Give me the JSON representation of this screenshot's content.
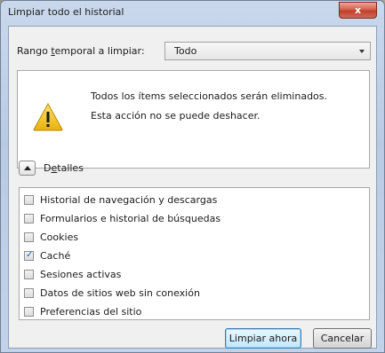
{
  "window": {
    "title": "Limpiar todo el historial",
    "close_glyph": "x"
  },
  "range": {
    "label_pre": "Rango ",
    "label_underlined": "t",
    "label_post": "emporal a limpiar:",
    "selected": "Todo"
  },
  "warning": {
    "icon": "warning-triangle-icon",
    "line1": "Todos los ítems seleccionados serán eliminados.",
    "line2": "Esta acción no se puede deshacer."
  },
  "details": {
    "label_pre": "D",
    "label_underlined": "e",
    "label_post": "talles",
    "expanded": true
  },
  "items": [
    {
      "label": "Historial de navegación y descargas",
      "checked": false
    },
    {
      "label": "Formularios e historial de búsquedas",
      "checked": false
    },
    {
      "label": "Cookies",
      "checked": false
    },
    {
      "label": "Caché",
      "checked": true
    },
    {
      "label": "Sesiones activas",
      "checked": false
    },
    {
      "label": "Datos de sitios web sin conexión",
      "checked": false
    },
    {
      "label": "Preferencias del sitio",
      "checked": false
    }
  ],
  "buttons": {
    "clear_now": "Limpiar ahora",
    "cancel": "Cancelar"
  },
  "colors": {
    "accent": "#3c7fb1",
    "warning_yellow": "#f2c21a",
    "close_red": "#c1402b"
  }
}
